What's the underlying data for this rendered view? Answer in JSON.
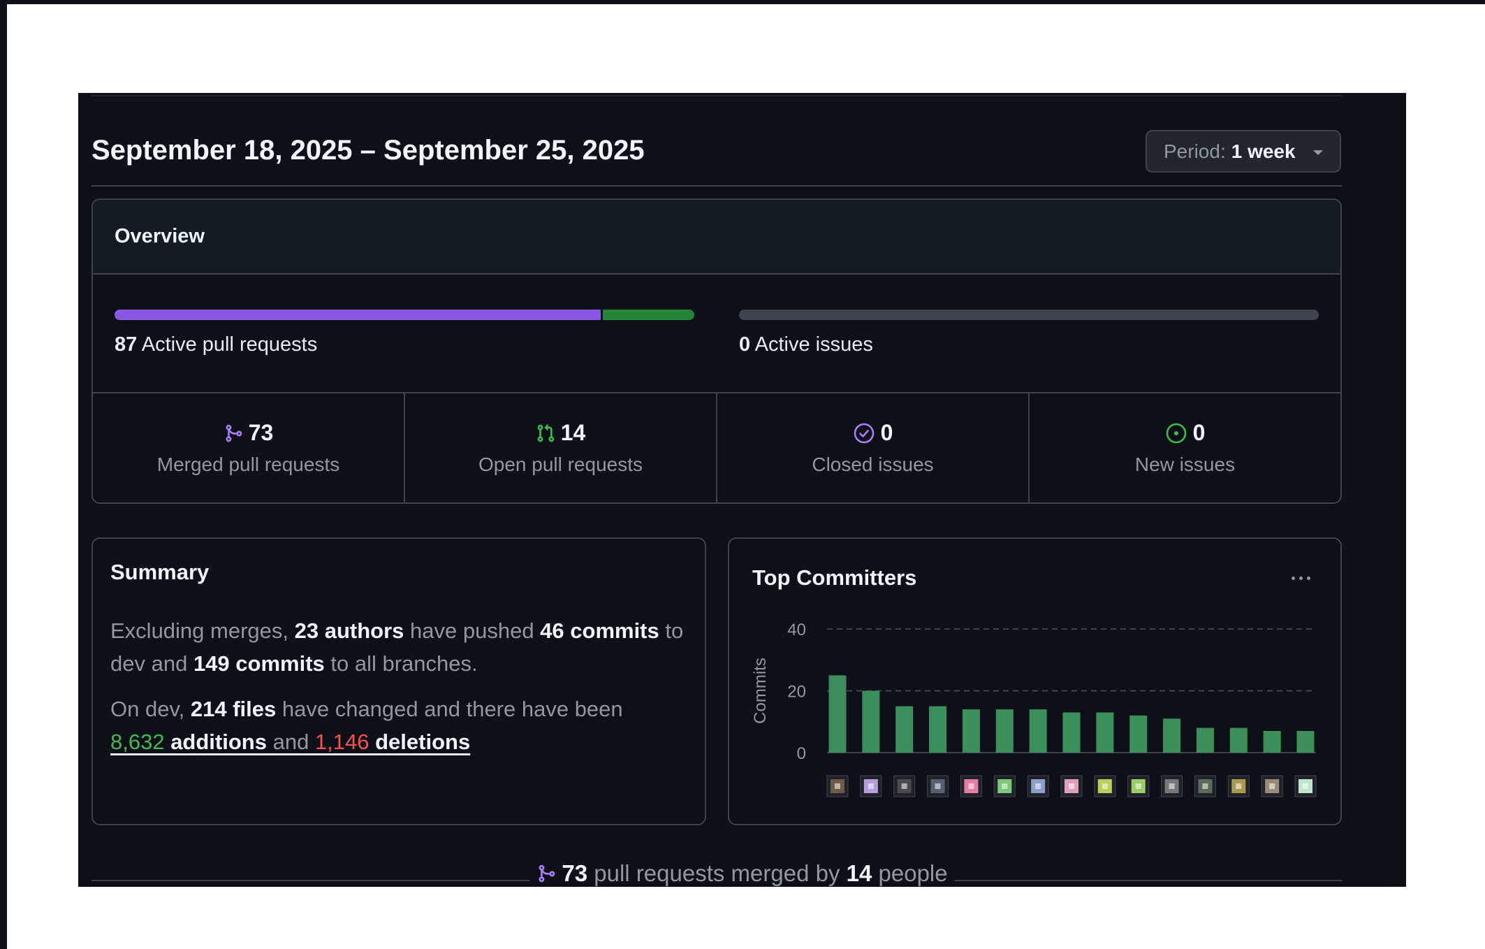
{
  "header": {
    "date_range": "September 18, 2025 – September 25, 2025",
    "period_label": "Period:",
    "period_value": "1 week"
  },
  "overview": {
    "title": "Overview",
    "active_prs_count": "87",
    "active_prs_label": "Active pull requests",
    "active_prs_merged_fraction": 0.839,
    "active_issues_count": "0",
    "active_issues_label": "Active issues",
    "stats": [
      {
        "icon": "git-merge-icon",
        "value": "73",
        "label": "Merged pull requests",
        "color": "#ab7df8"
      },
      {
        "icon": "git-pull-request-icon",
        "value": "14",
        "label": "Open pull requests",
        "color": "#3fb950"
      },
      {
        "icon": "issue-closed-icon",
        "value": "0",
        "label": "Closed issues",
        "color": "#ab7df8"
      },
      {
        "icon": "issue-opened-icon",
        "value": "0",
        "label": "New issues",
        "color": "#3fb950"
      }
    ]
  },
  "summary": {
    "title": "Summary",
    "p1_a": "Excluding merges, ",
    "authors": "23 authors",
    "p1_b": " have pushed ",
    "commits_dev": "46 commits",
    "p1_c": " to dev and ",
    "commits_all": "149 commits",
    "p1_d": " to all branches.",
    "p2_a": "On dev, ",
    "files": "214 files",
    "p2_b": " have changed and there have been ",
    "additions_num": "8,632",
    "additions_word": " additions",
    "and": " and ",
    "deletions_num": "1,146",
    "deletions_word": " deletions"
  },
  "committers": {
    "title": "Top Committers",
    "more_label": "More options"
  },
  "chart_data": {
    "type": "bar",
    "ylabel": "Commits",
    "ylim": [
      0,
      40
    ],
    "yticks": [
      0,
      20,
      40
    ],
    "grid": "dashed horizontal",
    "categories": [
      "committer-1",
      "committer-2",
      "committer-3",
      "committer-4",
      "committer-5",
      "committer-6",
      "committer-7",
      "committer-8",
      "committer-9",
      "committer-10",
      "committer-11",
      "committer-12",
      "committer-13",
      "committer-14",
      "committer-15"
    ],
    "values": [
      25,
      20,
      15,
      15,
      14,
      14,
      14,
      13,
      13,
      12,
      11,
      8,
      8,
      7,
      7
    ],
    "bar_color": "#3b8f5a"
  },
  "footer": {
    "merged_count": "73",
    "text_a": " pull requests merged by ",
    "people_count": "14",
    "text_b": " people"
  }
}
